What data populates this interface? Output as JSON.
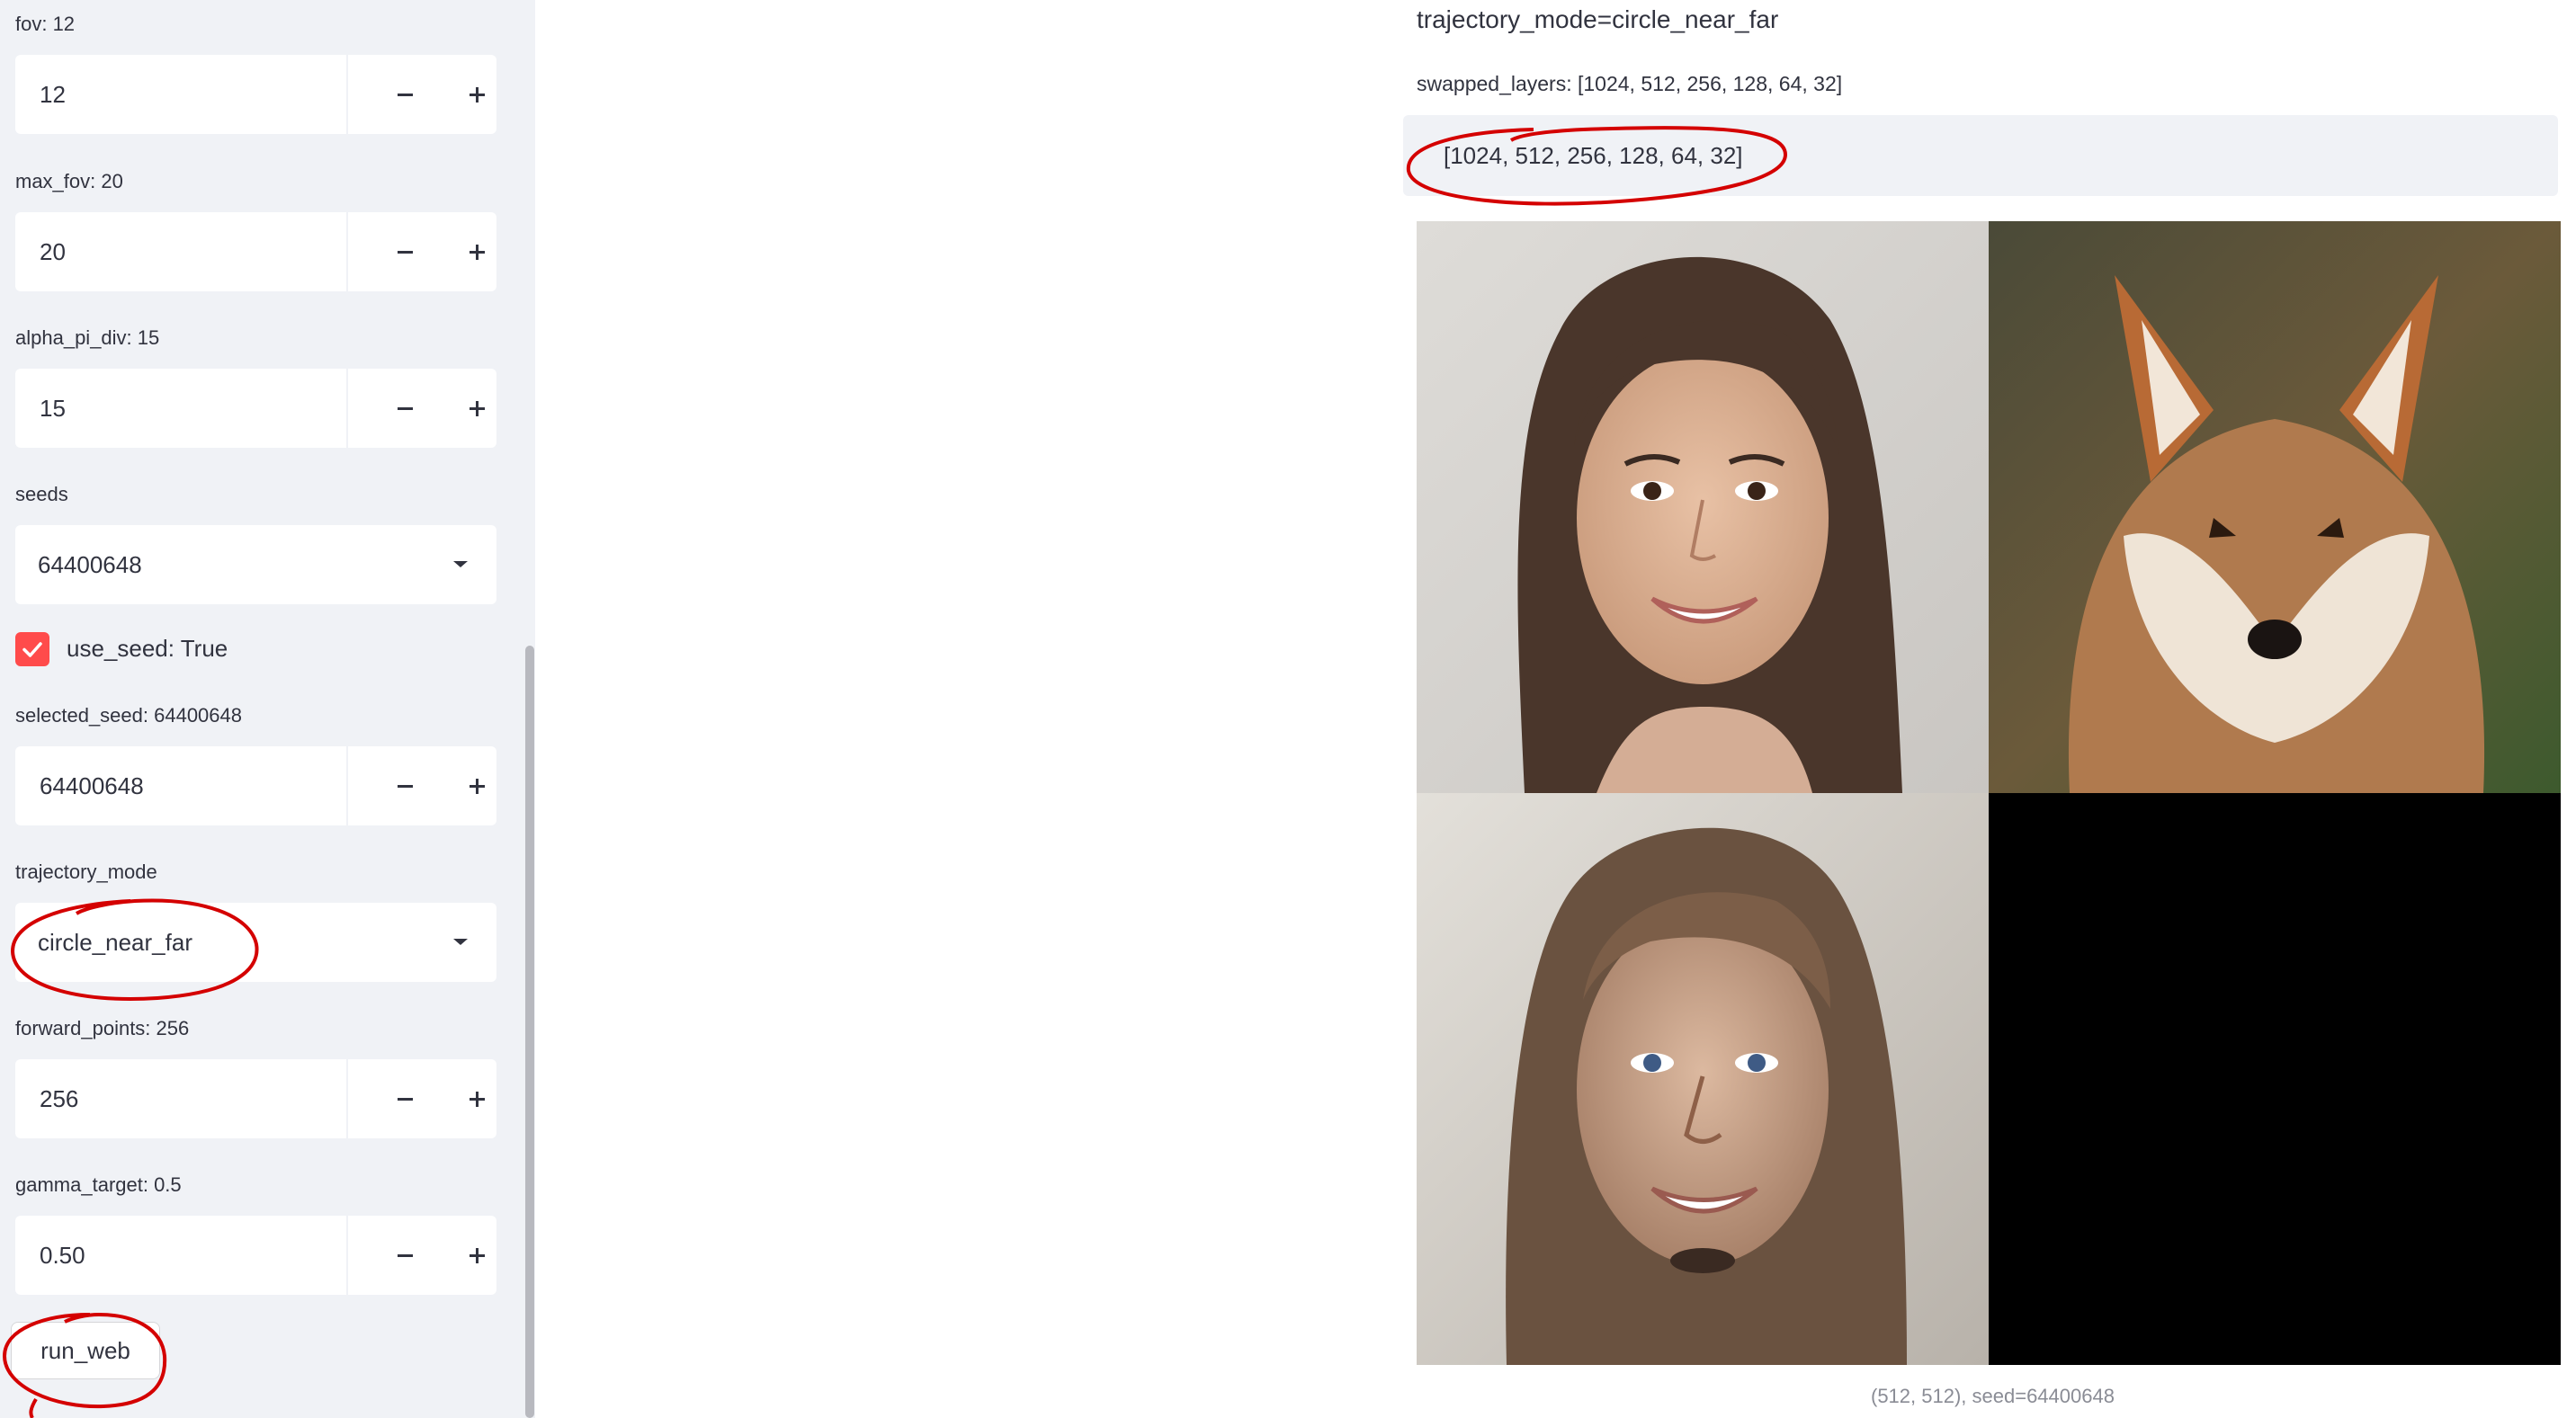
{
  "sidebar": {
    "fields": [
      {
        "label": "fov: 12",
        "value": "12"
      },
      {
        "label": "max_fov: 20",
        "value": "20"
      },
      {
        "label": "alpha_pi_div: 15",
        "value": "15"
      },
      {
        "label": "seeds",
        "value": "64400648"
      },
      {
        "label": "selected_seed: 64400648",
        "value": "64400648"
      },
      {
        "label": "trajectory_mode",
        "value": "circle_near_far"
      },
      {
        "label": "forward_points: 256",
        "value": "256"
      },
      {
        "label": "gamma_target: 0.5",
        "value": "0.50"
      }
    ],
    "checkbox": {
      "label": "use_seed: True",
      "checked": true
    },
    "run_button": "run_web"
  },
  "main": {
    "title": "trajectory_mode=circle_near_far",
    "swapped_label": "swapped_layers: [1024, 512, 256, 128, 64, 32]",
    "code": "[1024, 512, 256, 128, 64, 32]",
    "caption": "(512, 512), seed=64400648"
  },
  "colors": {
    "accent": "#ff4b4b",
    "sidebar_bg": "#f0f2f6",
    "text": "#31333f",
    "annotation": "#d40000"
  },
  "icons": [
    "minus-icon",
    "plus-icon",
    "chevron-down-icon",
    "check-icon"
  ]
}
